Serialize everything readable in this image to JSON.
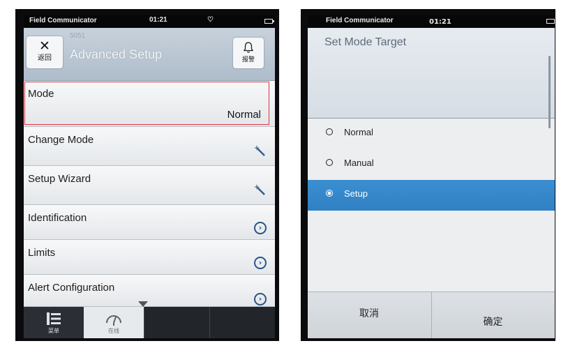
{
  "left_screen": {
    "status_bar": {
      "app_name": "Field Communicator",
      "time": "01:21",
      "heart_icon": "heart-icon",
      "battery_icon": "battery-icon"
    },
    "header": {
      "back_button": {
        "icon": "close-icon",
        "label": "返回"
      },
      "device_tag": "5051",
      "title": "Advanced Setup",
      "alarm_button": {
        "icon": "bell-icon",
        "label": "报警"
      }
    },
    "menu": [
      {
        "label": "Mode",
        "value": "Normal",
        "highlighted": true
      },
      {
        "label": "Change Mode",
        "icon": "wizard-wand-icon"
      },
      {
        "label": "Setup Wizard",
        "icon": "wizard-wand-icon"
      },
      {
        "label": "Identification",
        "icon": "chevron-right-circle-icon"
      },
      {
        "label": "Limits",
        "icon": "chevron-right-circle-icon"
      },
      {
        "label": "Alert Configuration",
        "icon": "chevron-right-circle-icon"
      }
    ],
    "tab_bar": [
      {
        "icon": "menu-list-icon",
        "label": "菜单"
      },
      {
        "icon": "gauge-icon",
        "label": "在线"
      }
    ]
  },
  "right_screen": {
    "status_bar": {
      "app_name": "Field Communicator",
      "time": "01:21",
      "battery_icon": "battery-icon"
    },
    "dialog_title": "Set Mode Target",
    "options": [
      {
        "label": "Normal",
        "selected": false
      },
      {
        "label": "Manual",
        "selected": false
      },
      {
        "label": "Setup",
        "selected": true
      }
    ],
    "buttons": {
      "cancel": "取消",
      "confirm": "确定"
    }
  },
  "colors": {
    "highlight_border": "#d9363e",
    "selection_blue": "#3586c9",
    "chevron_blue": "#25558a"
  }
}
